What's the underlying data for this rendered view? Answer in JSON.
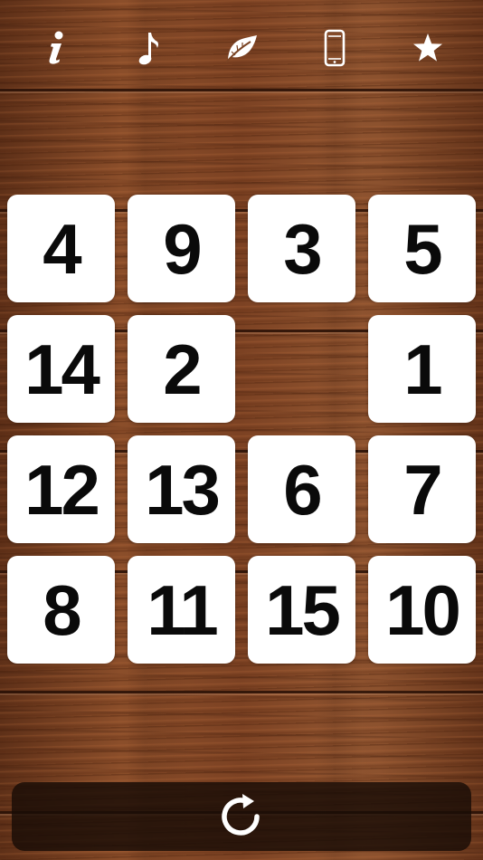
{
  "toolbar": {
    "buttons": [
      {
        "id": "info",
        "icon": "info-icon",
        "glyph": "i"
      },
      {
        "id": "music",
        "icon": "music-note-icon",
        "glyph": "♪"
      },
      {
        "id": "theme",
        "icon": "leaf-icon"
      },
      {
        "id": "device",
        "icon": "phone-icon"
      },
      {
        "id": "rate",
        "icon": "star-icon",
        "glyph": "★"
      }
    ]
  },
  "board": {
    "rows": 4,
    "cols": 4,
    "tiles": [
      [
        "4",
        "9",
        "3",
        "5"
      ],
      [
        "14",
        "2",
        "",
        "1"
      ],
      [
        "12",
        "13",
        "6",
        "7"
      ],
      [
        "8",
        "11",
        "15",
        "10"
      ]
    ]
  },
  "footer": {
    "icon": "refresh-icon"
  },
  "colors": {
    "tile_bg": "#ffffff",
    "tile_text": "#0a0a0a",
    "icon": "#ffffff",
    "footer_bg": "#190c06"
  }
}
